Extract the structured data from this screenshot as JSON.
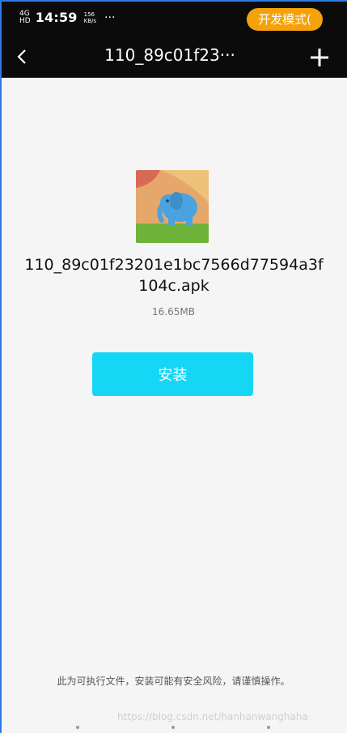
{
  "status": {
    "network": "4G",
    "signal_label": "HD",
    "time": "14:59",
    "speed_value": "156",
    "speed_unit": "KB/s",
    "more": "···"
  },
  "badge": {
    "label": "开发模式("
  },
  "nav": {
    "title": "110_89c01f23···"
  },
  "app": {
    "filename": "110_89c01f23201e1bc7566d77594a3f104c.apk",
    "size": "16.65MB",
    "install_label": "安装"
  },
  "footer": {
    "warning": "此为可执行文件，安装可能有安全风险，请谨慎操作。",
    "watermark": "https://blog.csdn.net/hanhanwanghaha"
  },
  "colors": {
    "install_button": "#16d6f5",
    "badge": "#f5a10a",
    "top_bar": "#0b0b0b"
  }
}
